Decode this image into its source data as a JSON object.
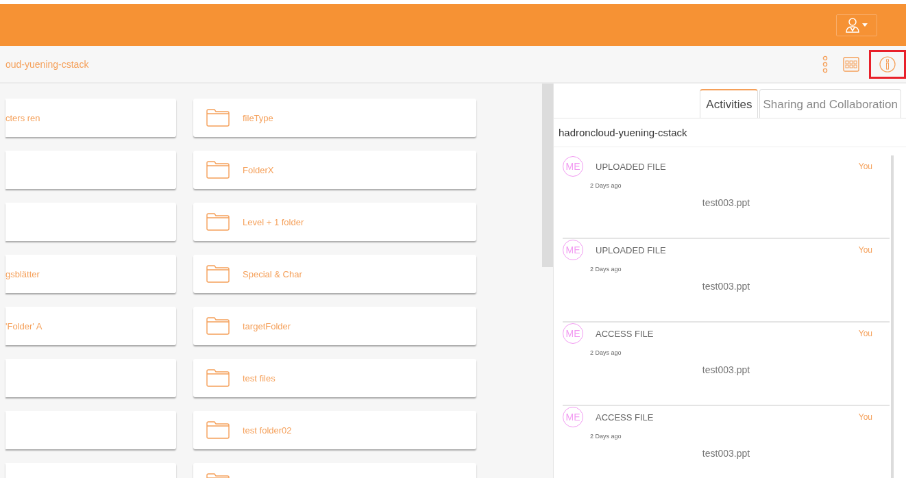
{
  "breadcrumb": "oud-yuening-cstack",
  "toolbar": {
    "info_highlighted": true
  },
  "folders_left": [
    {
      "kind": "folder",
      "name": "cters ren"
    },
    {
      "kind": "folder"
    },
    {
      "kind": "folder"
    },
    {
      "kind": "folder",
      "name": "gsblätter"
    },
    {
      "kind": "folder",
      "name": "'Folder' A"
    },
    {
      "kind": "folder"
    },
    {
      "kind": "folder"
    },
    {
      "kind": "folder"
    }
  ],
  "folders_right": [
    {
      "kind": "folder",
      "name": "fileType"
    },
    {
      "kind": "folder",
      "name": "FolderX"
    },
    {
      "kind": "folder",
      "name": "Level + 1 folder"
    },
    {
      "kind": "folder",
      "name": "Special & Char"
    },
    {
      "kind": "folder",
      "name": "targetFolder"
    },
    {
      "kind": "folder",
      "name": "test files"
    },
    {
      "kind": "folder",
      "name": "test folder02"
    },
    {
      "kind": "folder"
    }
  ],
  "tabs": [
    {
      "label": "Activities",
      "selected": true
    },
    {
      "label": "Sharing and Collaboration",
      "selected": false
    }
  ],
  "panel_title": "hadroncloud-yuening-cstack",
  "activities": [
    {
      "avatar": "ME",
      "action": "UPLOADED FILE",
      "user": "You",
      "time": "2 Days ago",
      "file": "test003.ppt"
    },
    {
      "avatar": "ME",
      "action": "UPLOADED FILE",
      "user": "You",
      "time": "2 Days ago",
      "file": "test003.ppt"
    },
    {
      "avatar": "ME",
      "action": "ACCESS FILE",
      "user": "You",
      "time": "2 Days ago",
      "file": "test003.ppt"
    },
    {
      "avatar": "ME",
      "action": "ACCESS FILE",
      "user": "You",
      "time": "2 Days ago",
      "file": "test003.ppt"
    }
  ]
}
